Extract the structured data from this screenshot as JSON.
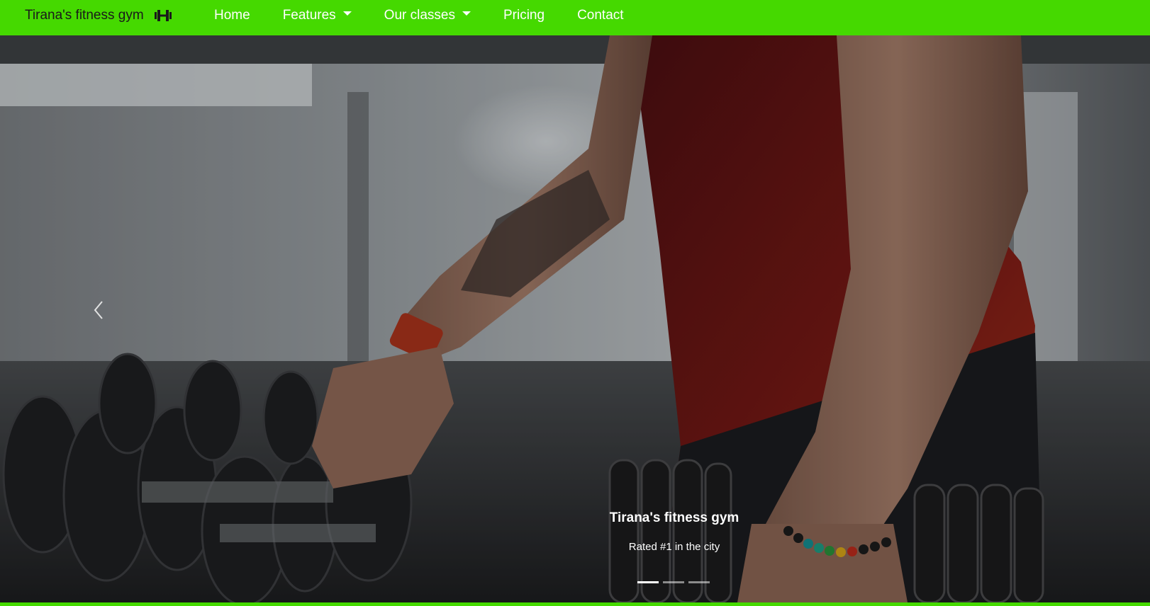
{
  "navbar": {
    "brand": "Tirana's fitness gym",
    "brand_icon": "dumbbell-icon",
    "items": [
      {
        "label": "Home",
        "dropdown": false
      },
      {
        "label": "Features",
        "dropdown": true
      },
      {
        "label": "Our classes",
        "dropdown": true
      },
      {
        "label": "Pricing",
        "dropdown": false
      },
      {
        "label": "Contact",
        "dropdown": false
      }
    ],
    "background_color": "#45d900"
  },
  "carousel": {
    "caption_title": "Tirana's fitness gym",
    "caption_subtitle": "Rated #1 in the city",
    "slide_count": 3,
    "active_slide": 1,
    "prev_icon": "chevron-left-icon"
  }
}
